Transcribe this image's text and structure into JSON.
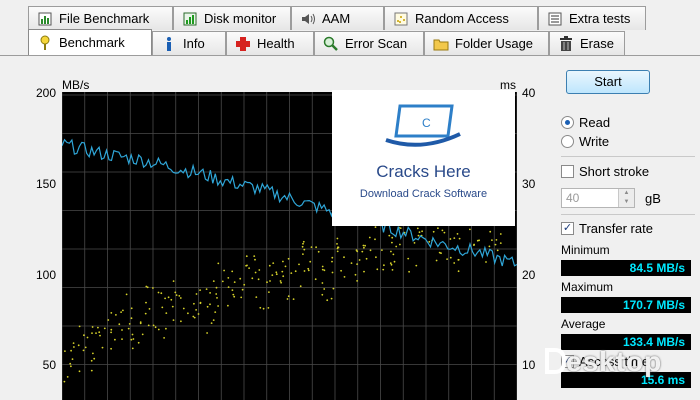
{
  "tabs_row1": [
    {
      "label": "File Benchmark",
      "icon": "file-benchmark-icon"
    },
    {
      "label": "Disk monitor",
      "icon": "disk-monitor-icon"
    },
    {
      "label": "AAM",
      "icon": "speaker-icon"
    },
    {
      "label": "Random Access",
      "icon": "random-access-icon"
    },
    {
      "label": "Extra tests",
      "icon": "extra-tests-icon"
    }
  ],
  "tabs_row2": [
    {
      "label": "Benchmark",
      "icon": "benchmark-icon",
      "active": true
    },
    {
      "label": "Info",
      "icon": "info-icon"
    },
    {
      "label": "Health",
      "icon": "health-cross-icon"
    },
    {
      "label": "Error Scan",
      "icon": "magnifier-icon"
    },
    {
      "label": "Folder Usage",
      "icon": "folder-icon"
    },
    {
      "label": "Erase",
      "icon": "trash-icon"
    }
  ],
  "chart": {
    "left_unit": "MB/s",
    "right_unit": "ms",
    "left_ticks": [
      "200",
      "150",
      "100",
      "50"
    ],
    "right_ticks": [
      "40",
      "30",
      "20",
      "10"
    ]
  },
  "chart_data": {
    "type": "line",
    "xlabel": "",
    "ylabel": "MB/s",
    "y2label": "ms",
    "ylim": [
      0,
      200
    ],
    "y2lim": [
      0,
      40
    ],
    "grid": true,
    "series": [
      {
        "axis": "left",
        "color": "#2fa6d8",
        "values": [
          166,
          163,
          160,
          158,
          156,
          153,
          150,
          147,
          143,
          140,
          137,
          133,
          129,
          125,
          121,
          118,
          114,
          110,
          106,
          102,
          99,
          96,
          92,
          88
        ]
      }
    ],
    "scatter": {
      "axis": "right",
      "color": "#d6d22a",
      "x": [
        0.02,
        0.05,
        0.08,
        0.11,
        0.14,
        0.17,
        0.2,
        0.23,
        0.26,
        0.29,
        0.32,
        0.35,
        0.38,
        0.41,
        0.44,
        0.47,
        0.5,
        0.53,
        0.56,
        0.59,
        0.62,
        0.65,
        0.68,
        0.71,
        0.74,
        0.77,
        0.8,
        0.83,
        0.86,
        0.89,
        0.92,
        0.95
      ],
      "y": [
        6,
        8,
        9,
        10,
        12,
        11,
        13,
        12,
        14,
        15,
        13,
        16,
        15,
        17,
        16,
        18,
        17,
        19,
        18,
        17,
        20,
        19,
        21,
        20,
        22,
        21,
        23,
        22,
        21,
        24,
        22,
        23
      ]
    }
  },
  "watermark": {
    "title": "Cracks Here",
    "subtitle": "Download Crack Software",
    "badge_letter": "C"
  },
  "panel": {
    "start_label": "Start",
    "read_label": "Read",
    "write_label": "Write",
    "short_stroke_label": "Short stroke",
    "short_stroke_value": "40",
    "short_stroke_unit": "gB",
    "transfer_rate_label": "Transfer rate",
    "minimum_label": "Minimum",
    "minimum_value": "84.5 MB/s",
    "maximum_label": "Maximum",
    "maximum_value": "170.7 MB/s",
    "average_label": "Average",
    "average_value": "133.4 MB/s",
    "access_time_label": "Access time",
    "access_time_value": "15.6 ms"
  },
  "desktop_watermark": "esktop",
  "colors": {
    "plot_bg": "#000000",
    "grid": "#4a4a4a",
    "line": "#2fa6d8",
    "dots": "#d6d22a",
    "readout_text": "#00e8ff"
  }
}
